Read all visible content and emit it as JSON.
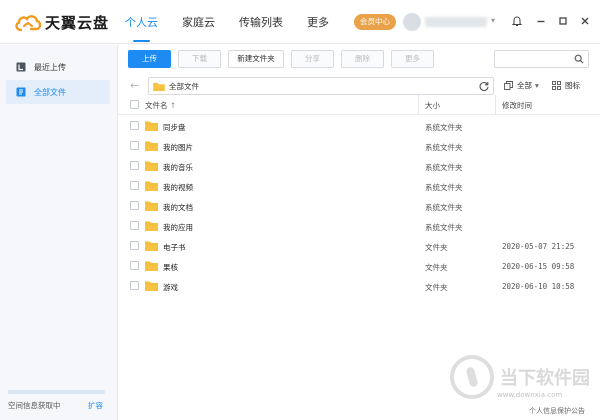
{
  "app": {
    "name": "天翼云盘",
    "colors": {
      "accent": "#1d8bf1",
      "vip": "#e9a24a",
      "folder": "#f6c343"
    }
  },
  "nav": [
    "个人云",
    "家庭云",
    "传输列表",
    "更多"
  ],
  "header": {
    "vip_label": "会员中心",
    "icons": [
      "bell-icon",
      "minimize-icon",
      "maximize-icon",
      "close-icon"
    ]
  },
  "sidebar": {
    "items": [
      {
        "label": "最近上传",
        "icon": "recent-icon"
      },
      {
        "label": "全部文件",
        "icon": "all-files-icon"
      }
    ],
    "space_text": "空间信息获取中",
    "expand_label": "扩容"
  },
  "toolbar": {
    "buttons": [
      "上传",
      "下载",
      "新建文件夹",
      "分享",
      "删除",
      "更多"
    ]
  },
  "path": {
    "current": "全部文件",
    "filter_label": "全部",
    "view_label": "图标"
  },
  "table": {
    "headers": {
      "name": "文件名",
      "sort": "↑",
      "size": "大小",
      "modified": "修改时间"
    },
    "rows": [
      {
        "name": "同步盘",
        "type": "系统文件夹",
        "date": ""
      },
      {
        "name": "我的图片",
        "type": "系统文件夹",
        "date": ""
      },
      {
        "name": "我的音乐",
        "type": "系统文件夹",
        "date": ""
      },
      {
        "name": "我的视频",
        "type": "系统文件夹",
        "date": ""
      },
      {
        "name": "我的文档",
        "type": "系统文件夹",
        "date": ""
      },
      {
        "name": "我的应用",
        "type": "系统文件夹",
        "date": ""
      },
      {
        "name": "电子书",
        "type": "文件夹",
        "date": "2020-05-07 21:25"
      },
      {
        "name": "果核",
        "type": "文件夹",
        "date": "2020-06-15 09:58"
      },
      {
        "name": "游戏",
        "type": "文件夹",
        "date": "2020-06-10 10:58"
      }
    ]
  },
  "footer": {
    "notice": "个人信息保护公告"
  },
  "watermark": {
    "text": "当下软件园",
    "sub": "www.downxia.com"
  }
}
